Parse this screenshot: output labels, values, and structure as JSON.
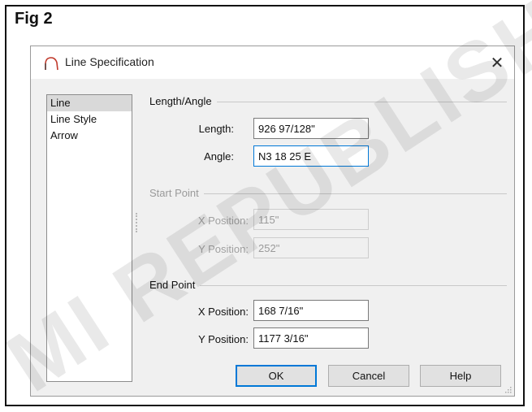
{
  "figure": {
    "title": "Fig 2"
  },
  "watermark": {
    "text": "MI REPUBLISHED"
  },
  "dialog": {
    "title": "Line Specification",
    "close_symbol": "✕",
    "icon": "arc-line-icon",
    "tabs": [
      {
        "label": "Line",
        "selected": true
      },
      {
        "label": "Line Style",
        "selected": false
      },
      {
        "label": "Arrow",
        "selected": false
      }
    ],
    "length_angle": {
      "heading": "Length/Angle",
      "length_label": "Length:",
      "length_value": "926 97/128\"",
      "angle_label": "Angle:",
      "angle_value": "N3 18 25 E"
    },
    "start_point": {
      "heading": "Start Point",
      "x_label": "X Position:",
      "x_value": "115\"",
      "y_label": "Y Position:",
      "y_value": "252\""
    },
    "end_point": {
      "heading": "End Point",
      "x_label": "X Position:",
      "x_value": "168 7/16\"",
      "y_label": "Y Position:",
      "y_value": "1177 3/16\""
    },
    "buttons": {
      "ok": "OK",
      "cancel": "Cancel",
      "help": "Help"
    },
    "accent_color": "#0078d7",
    "arc_icon_color": "#c0392b"
  }
}
